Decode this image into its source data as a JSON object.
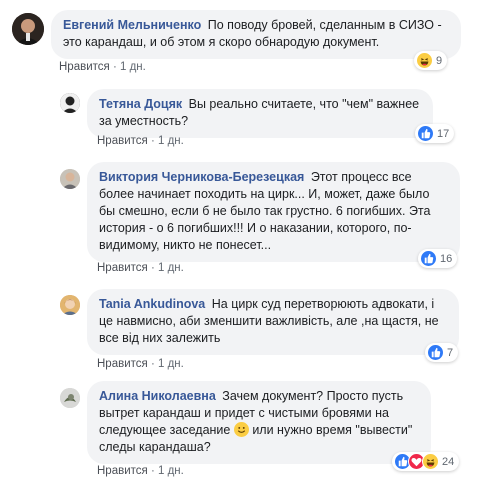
{
  "comments": [
    {
      "author": "Евгений Мельниченко",
      "text": "По поводу бровей, сделанным в СИЗО - это карандаш, и об этом я скоро обнародую документ.",
      "like_label": "Нравится",
      "time": "1 дн.",
      "reaction_count": "9",
      "reactions": [
        "haha-icon"
      ]
    },
    {
      "author": "Тетяна Доцяк",
      "text": "Вы реально считаете, что \"чем\" важнее за уместность?",
      "like_label": "Нравится",
      "time": "1 дн.",
      "reaction_count": "17",
      "reactions": [
        "like-icon"
      ]
    },
    {
      "author": "Виктория Черникова-Березецкая",
      "text": "Этот процесс все более начинает походить на цирк... И, может, даже было бы смешно, если б не было так грустно. 6 погибших. Эта история - о 6 погибших!!! И о наказании, которого, по-видимому, никто не понесет...",
      "like_label": "Нравится",
      "time": "1 дн.",
      "reaction_count": "16",
      "reactions": [
        "like-icon"
      ]
    },
    {
      "author": "Tania Ankudinova",
      "text": "На цирк суд перетворюють адвокати, і це навмисно, аби зменшити важливість, але ,на щастя, не все від них залежить",
      "like_label": "Нравится",
      "time": "1 дн.",
      "reaction_count": "7",
      "reactions": [
        "like-icon"
      ]
    },
    {
      "author": "Алина Николаевна",
      "text_before": "Зачем документ? Просто пусть вытрет карандаш и придет с чистыми бровями на следующее заседание",
      "text_after": "или нужно время \"вывести\" следы карандаша?",
      "like_label": "Нравится",
      "time": "1 дн.",
      "reaction_count": "24",
      "reactions": [
        "like-icon",
        "heart-icon",
        "haha-icon"
      ]
    }
  ],
  "colors": {
    "author": "#385898",
    "bubble": "#f2f3f5",
    "like": "#2f7af7",
    "heart": "#f0284a",
    "haha": "#fbcd43"
  }
}
